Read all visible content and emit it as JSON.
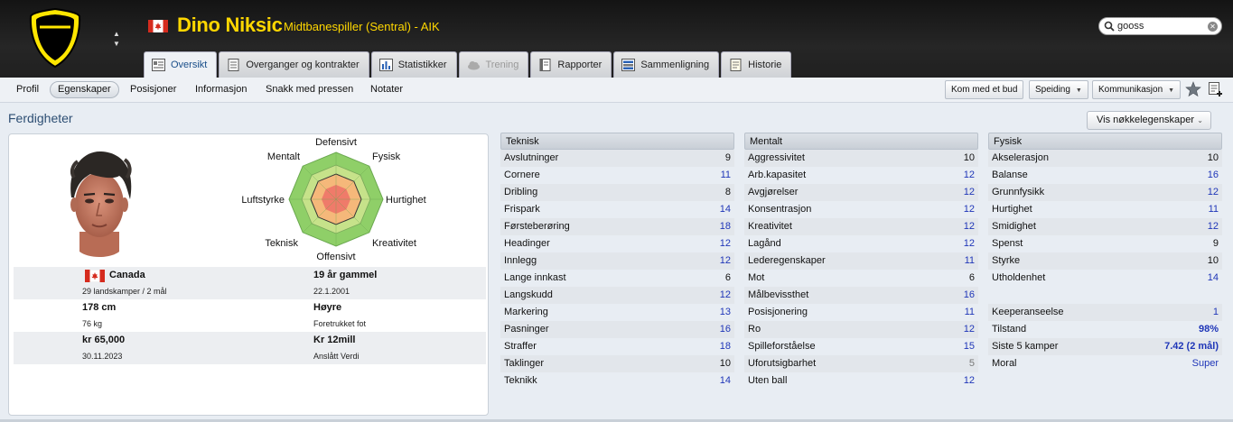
{
  "header": {
    "player_name": "Dino Niksic",
    "player_role": "Midtbanespiller (Sentral) - AIK",
    "flag_icon": "canada-flag-icon",
    "search": {
      "value": "gooss",
      "placeholder": ""
    },
    "accent": "#ffd700"
  },
  "tabs": [
    {
      "label": "Oversikt",
      "state": "active"
    },
    {
      "label": "Overganger og kontrakter",
      "state": "normal"
    },
    {
      "label": "Statistikker",
      "state": "normal"
    },
    {
      "label": "Trening",
      "state": "disabled"
    },
    {
      "label": "Rapporter",
      "state": "normal"
    },
    {
      "label": "Sammenligning",
      "state": "normal"
    },
    {
      "label": "Historie",
      "state": "normal"
    }
  ],
  "subnav": {
    "items": [
      "Profil",
      "Egenskaper",
      "Posisjoner",
      "Informasjon",
      "Snakk med pressen",
      "Notater"
    ],
    "active": "Egenskaper",
    "buttons": {
      "kom_med_et_bud": "Kom med et bud",
      "speiding": "Speiding",
      "kommunikasjon": "Kommunikasjon"
    }
  },
  "section": {
    "title": "Ferdigheter",
    "key_attributes_button": "Vis nøkkelegenskaper"
  },
  "radar": {
    "labels": [
      "Defensivt",
      "Fysisk",
      "Hurtighet",
      "Kreativitet",
      "Offensivt",
      "Teknisk",
      "Luftstyrke",
      "Mentalt"
    ]
  },
  "info": {
    "nation": "Canada",
    "caps": "29 landskamper / 2 mål",
    "age": "19 år gammel",
    "dob": "22.1.2001",
    "height": "178 cm",
    "weight": "76 kg",
    "foot": "Høyre",
    "foot_label": "Foretrukket fot",
    "wage": "kr 65,000",
    "contract_end": "30.11.2023",
    "value": "Kr 12mill",
    "value_label": "Anslått Verdi"
  },
  "technical": {
    "title": "Teknisk",
    "rows": [
      {
        "name": "Avslutninger",
        "value": "9",
        "tone": "plain"
      },
      {
        "name": "Cornere",
        "value": "11",
        "tone": "blue"
      },
      {
        "name": "Dribling",
        "value": "8",
        "tone": "plain"
      },
      {
        "name": "Frispark",
        "value": "14",
        "tone": "blue"
      },
      {
        "name": "Førsteberøring",
        "value": "18",
        "tone": "blue"
      },
      {
        "name": "Headinger",
        "value": "12",
        "tone": "blue"
      },
      {
        "name": "Innlegg",
        "value": "12",
        "tone": "blue"
      },
      {
        "name": "Lange innkast",
        "value": "6",
        "tone": "plain"
      },
      {
        "name": "Langskudd",
        "value": "12",
        "tone": "blue"
      },
      {
        "name": "Markering",
        "value": "13",
        "tone": "blue"
      },
      {
        "name": "Pasninger",
        "value": "16",
        "tone": "blue"
      },
      {
        "name": "Straffer",
        "value": "18",
        "tone": "blue"
      },
      {
        "name": "Taklinger",
        "value": "10",
        "tone": "plain"
      },
      {
        "name": "Teknikk",
        "value": "14",
        "tone": "blue"
      }
    ]
  },
  "mental": {
    "title": "Mentalt",
    "rows": [
      {
        "name": "Aggressivitet",
        "value": "10",
        "tone": "plain"
      },
      {
        "name": "Arb.kapasitet",
        "value": "12",
        "tone": "blue"
      },
      {
        "name": "Avgjørelser",
        "value": "12",
        "tone": "blue"
      },
      {
        "name": "Konsentrasjon",
        "value": "12",
        "tone": "blue"
      },
      {
        "name": "Kreativitet",
        "value": "12",
        "tone": "blue"
      },
      {
        "name": "Lagånd",
        "value": "12",
        "tone": "blue"
      },
      {
        "name": "Lederegenskaper",
        "value": "11",
        "tone": "blue"
      },
      {
        "name": "Mot",
        "value": "6",
        "tone": "plain"
      },
      {
        "name": "Målbevissthet",
        "value": "16",
        "tone": "blue"
      },
      {
        "name": "Posisjonering",
        "value": "11",
        "tone": "blue"
      },
      {
        "name": "Ro",
        "value": "12",
        "tone": "blue"
      },
      {
        "name": "Spilleforståelse",
        "value": "15",
        "tone": "blue"
      },
      {
        "name": "Uforutsigbarhet",
        "value": "5",
        "tone": "grey"
      },
      {
        "name": "Uten ball",
        "value": "12",
        "tone": "blue"
      }
    ]
  },
  "physical": {
    "title": "Fysisk",
    "rows": [
      {
        "name": "Akselerasjon",
        "value": "10",
        "tone": "plain"
      },
      {
        "name": "Balanse",
        "value": "16",
        "tone": "blue"
      },
      {
        "name": "Grunnfysikk",
        "value": "12",
        "tone": "blue"
      },
      {
        "name": "Hurtighet",
        "value": "11",
        "tone": "blue"
      },
      {
        "name": "Smidighet",
        "value": "12",
        "tone": "blue"
      },
      {
        "name": "Spenst",
        "value": "9",
        "tone": "plain"
      },
      {
        "name": "Styrke",
        "value": "10",
        "tone": "plain"
      },
      {
        "name": "Utholdenhet",
        "value": "14",
        "tone": "blue"
      }
    ],
    "extra": [
      {
        "name": "Keeperanseelse",
        "value": "1",
        "tone": "blue"
      },
      {
        "name": "Tilstand",
        "value": "98%",
        "tone": "hi"
      },
      {
        "name": "Siste 5 kamper",
        "value": "7.42 (2 mål)",
        "tone": "hi"
      },
      {
        "name": "Moral",
        "value": "Super",
        "tone": "blue"
      }
    ]
  }
}
